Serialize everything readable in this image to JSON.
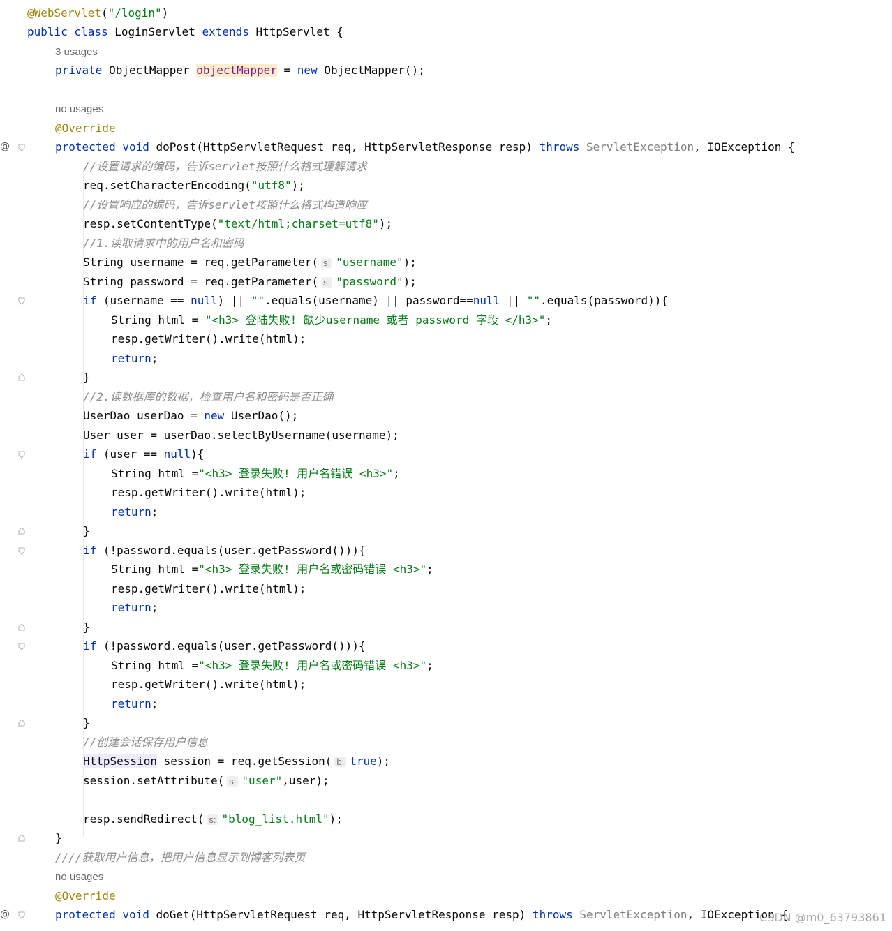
{
  "editor": {
    "lines": {
      "ann_webservlet": "@WebServlet",
      "l1_open": "(",
      "l1_str": "\"/login\"",
      "l1_close": ")",
      "l2_kw1": "public class",
      "l2_name": " LoginServlet ",
      "l2_kw2": "extends",
      "l2_rest": " HttpServlet {",
      "hint_3usages": "3 usages",
      "l4_kw": "private",
      "l4_type": " ObjectMapper ",
      "l4_field": "objectMapper",
      "l4_eq": " = ",
      "l4_new": "new",
      "l4_rest": " ObjectMapper();",
      "hint_nousages1": "no usages",
      "override1": "@Override",
      "l8_kw": "protected void",
      "l8_m": " doPost(HttpServletRequest req, HttpServletResponse resp) ",
      "l8_throws": "throws",
      "l8_ex1": " ServletException",
      "l8_rest": ", IOException {",
      "c1": "//设置请求的编码，告诉servlet按照什么格式理解请求",
      "l10_a": "req.setCharacterEncoding(",
      "l10_s": "\"utf8\"",
      "l10_b": ");",
      "c2": "//设置响应的编码，告诉servlet按照什么格式构造响应",
      "l12_a": "resp.setContentType(",
      "l12_s": "\"text/html;charset=utf8\"",
      "l12_b": ");",
      "c3": "//1.读取请求中的用户名和密码",
      "l14_a": "String username = req.getParameter(",
      "ph_s": "s:",
      "l14_s": "\"username\"",
      "l14_b": ");",
      "l15_a": "String password = req.getParameter(",
      "l15_s": "\"password\"",
      "l15_b": ");",
      "kw_if": "if",
      "l16_a": " (username == ",
      "kw_null": "null",
      "l16_b": ") || ",
      "l16_s": "\"\"",
      "l16_c": ".equals(username) || password==",
      "l16_d": " || ",
      "l16_e": ".equals(password)){",
      "l17_a": "String html = ",
      "l17_s": "\"<h3> 登陆失败! 缺少username 或者 password 字段 </h3>\"",
      "semi": ";",
      "write": "resp.getWriter().write(html);",
      "kw_return": "return",
      "brace_close": "}",
      "c4": "//2.读数据库的数据，检查用户名和密码是否正确",
      "l22_a": "UserDao userDao = ",
      "kw_new": "new",
      "l22_b": " UserDao();",
      "l23": "User user = userDao.selectByUsername(username);",
      "l24_a": " (user == ",
      "l24_b": "){",
      "l25_a": "String html =",
      "l25_s": "\"<h3> 登录失败! 用户名错误 <h3>\"",
      "l29_a": " (!password.equals(user.getPassword())){",
      "l30_s": "\"<h3> 登录失败! 用户名或密码错误 <h3>\"",
      "c5": "//创建会话保存用户信息",
      "l40_type": "HttpSession",
      "l40_a": " session = req.getSession(",
      "ph_b": "b:",
      "kw_true": "true",
      "l40_b": ");",
      "l41_a": "session.setAttribute(",
      "l41_s": "\"user\"",
      "l41_b": ",user);",
      "l43_a": "resp.sendRedirect(",
      "l43_s": "\"blog_list.html\"",
      "l43_b": ");",
      "c6": "////获取用户信息，把用户信息显示到博客列表页",
      "hint_nousages2": "no usages",
      "override2": "@Override",
      "l48_m": " doGet(HttpServletRequest req, HttpServletResponse resp) ",
      "l48_rest": ", IOException {"
    },
    "gutter_icons": {
      "override_marker": "@"
    }
  },
  "watermark": "CSDN @m0_63793861",
  "colors": {
    "keyword": "#0033b3",
    "string": "#067d17",
    "annotation": "#9e880d",
    "field": "#871094",
    "comment": "#8c8c8c",
    "background": "#ffffff"
  }
}
